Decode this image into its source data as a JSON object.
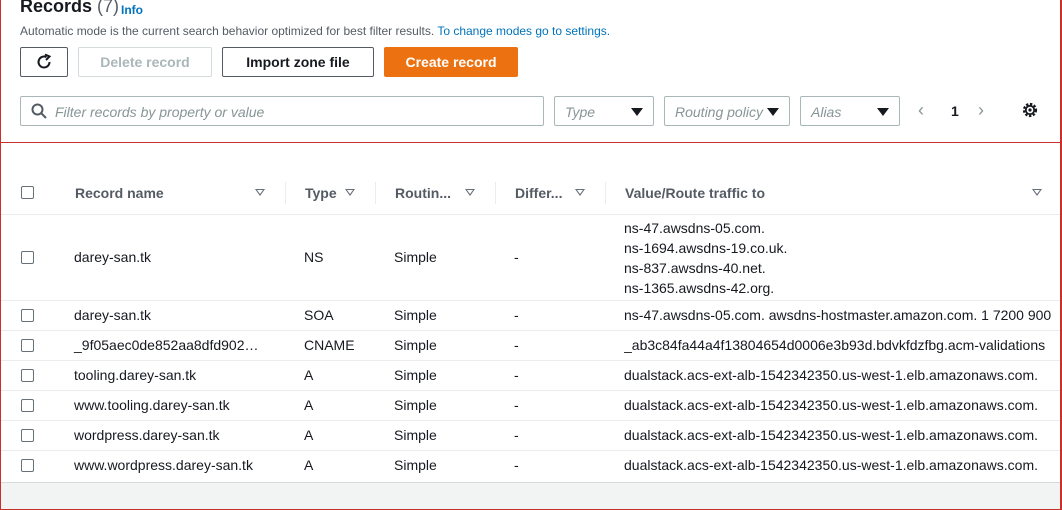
{
  "header": {
    "title": "Records",
    "count": "(7)",
    "info": "Info",
    "subtitle": "Automatic mode is the current search behavior optimized for best filter results.",
    "subtitle_link": "To change modes go to settings."
  },
  "toolbar": {
    "refresh_icon": "refresh-icon",
    "delete_label": "Delete record",
    "import_label": "Import zone file",
    "create_label": "Create record"
  },
  "filters": {
    "search_placeholder": "Filter records by property or value",
    "type_placeholder": "Type",
    "routing_placeholder": "Routing policy",
    "alias_placeholder": "Alias"
  },
  "pager": {
    "page": "1"
  },
  "columns": [
    "Record name",
    "Type",
    "Routin...",
    "Differ...",
    "Value/Route traffic to"
  ],
  "rows": [
    {
      "name": "darey-san.tk",
      "type": "NS",
      "routing": "Simple",
      "differ": "-",
      "value": [
        "ns-47.awsdns-05.com.",
        "ns-1694.awsdns-19.co.uk.",
        "ns-837.awsdns-40.net.",
        "ns-1365.awsdns-42.org."
      ]
    },
    {
      "name": "darey-san.tk",
      "type": "SOA",
      "routing": "Simple",
      "differ": "-",
      "value": [
        "ns-47.awsdns-05.com. awsdns-hostmaster.amazon.com. 1 7200 900"
      ]
    },
    {
      "name": "_9f05aec0de852aa8dfd902…",
      "type": "CNAME",
      "routing": "Simple",
      "differ": "-",
      "value": [
        "_ab3c84fa44a4f13804654d0006e3b93d.bdvkfdzfbg.acm-validations"
      ]
    },
    {
      "name": "tooling.darey-san.tk",
      "type": "A",
      "routing": "Simple",
      "differ": "-",
      "value": [
        "dualstack.acs-ext-alb-1542342350.us-west-1.elb.amazonaws.com."
      ]
    },
    {
      "name": "www.tooling.darey-san.tk",
      "type": "A",
      "routing": "Simple",
      "differ": "-",
      "value": [
        "dualstack.acs-ext-alb-1542342350.us-west-1.elb.amazonaws.com."
      ]
    },
    {
      "name": "wordpress.darey-san.tk",
      "type": "A",
      "routing": "Simple",
      "differ": "-",
      "value": [
        "dualstack.acs-ext-alb-1542342350.us-west-1.elb.amazonaws.com."
      ]
    },
    {
      "name": "www.wordpress.darey-san.tk",
      "type": "A",
      "routing": "Simple",
      "differ": "-",
      "value": [
        "dualstack.acs-ext-alb-1542342350.us-west-1.elb.amazonaws.com."
      ]
    }
  ]
}
